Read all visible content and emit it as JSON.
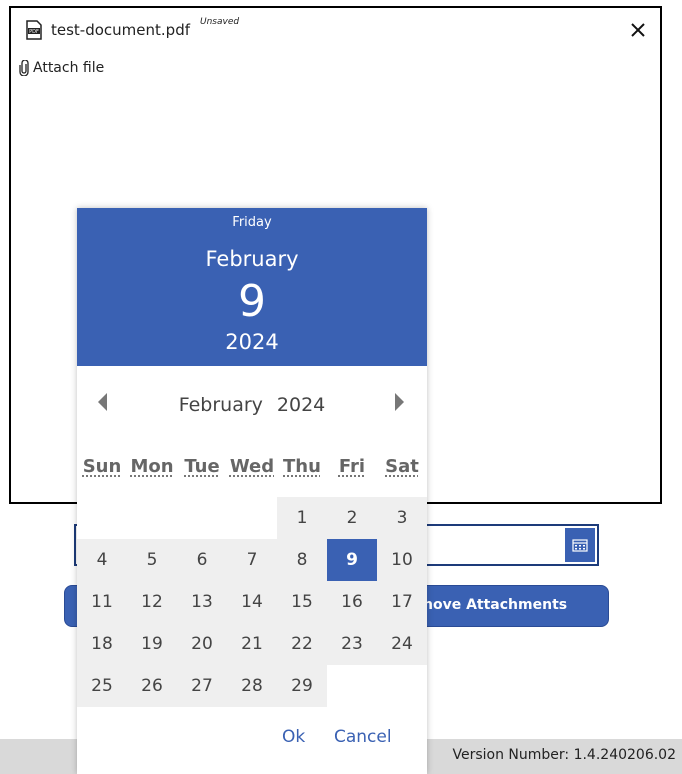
{
  "attachment": {
    "file_name": "test-document.pdf",
    "unsaved_label": "Unsaved",
    "attach_label": "Attach file"
  },
  "form": {
    "remove_label": "nove Attachments"
  },
  "footer": {
    "version": "Version Number: 1.4.240206.02"
  },
  "picker": {
    "header": {
      "weekday": "Friday",
      "month": "February",
      "date": "9",
      "year": "2024"
    },
    "nav": {
      "month": "February",
      "year": "2024"
    },
    "weekdays": [
      "Sun",
      "Mon",
      "Tue",
      "Wed",
      "Thu",
      "Fri",
      "Sat"
    ],
    "weeks": [
      [
        "",
        "",
        "",
        "",
        "1",
        "2",
        "3"
      ],
      [
        "4",
        "5",
        "6",
        "7",
        "8",
        "9",
        "10"
      ],
      [
        "11",
        "12",
        "13",
        "14",
        "15",
        "16",
        "17"
      ],
      [
        "18",
        "19",
        "20",
        "21",
        "22",
        "23",
        "24"
      ],
      [
        "25",
        "26",
        "27",
        "28",
        "29",
        "",
        ""
      ]
    ],
    "selected_day": "9",
    "ok_label": "Ok",
    "cancel_label": "Cancel"
  },
  "colors": {
    "accent": "#3a61b3",
    "day_bg": "#efefef",
    "footer_bg": "#d9d9d9"
  }
}
